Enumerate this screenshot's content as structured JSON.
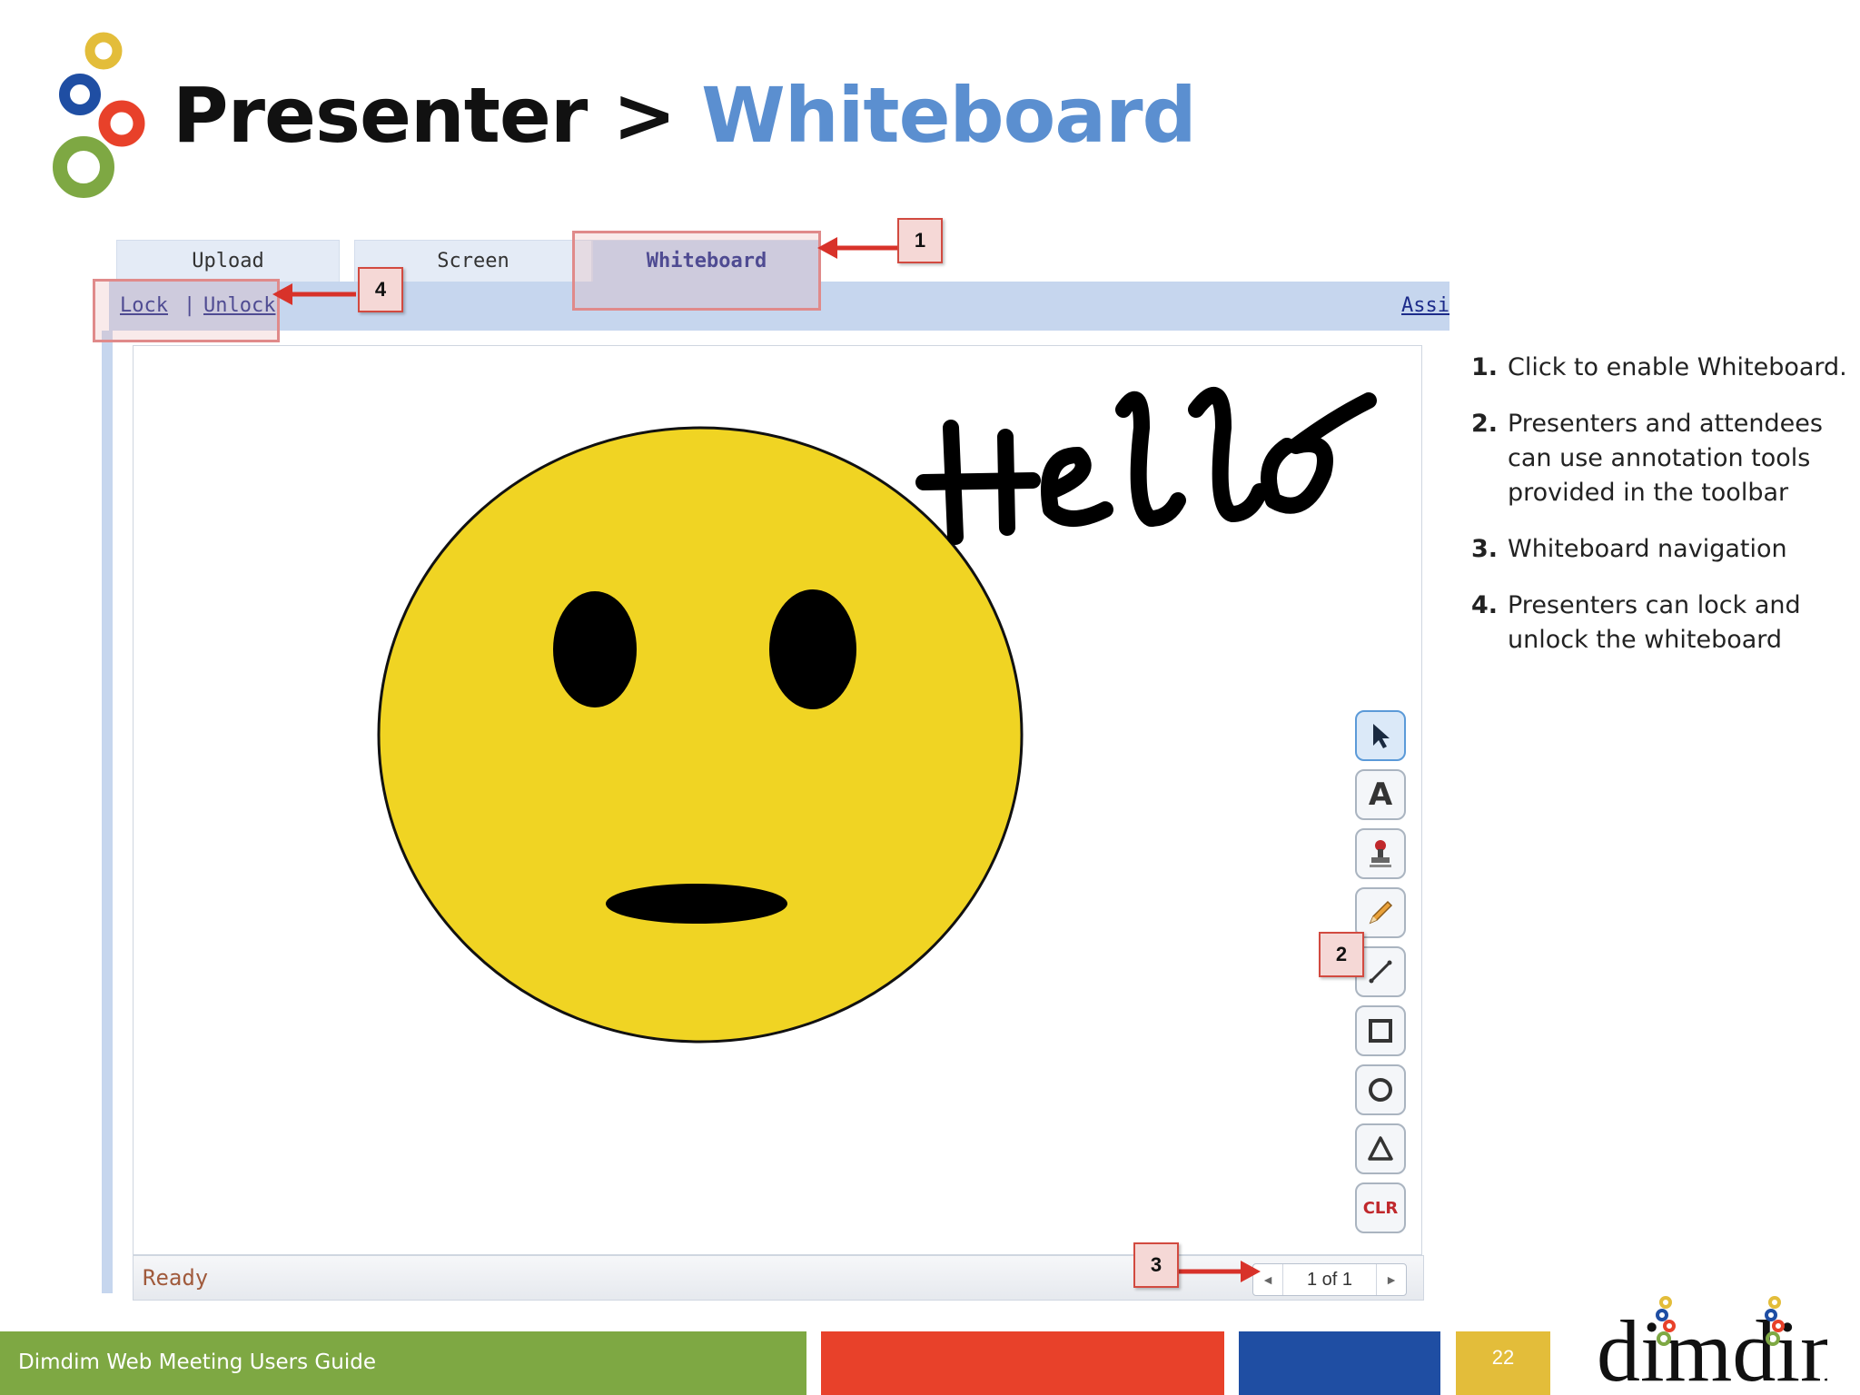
{
  "slide": {
    "title_part1": "Presenter >",
    "title_part2": "Whiteboard"
  },
  "tabs": [
    {
      "label": "Upload"
    },
    {
      "label": "Screen"
    },
    {
      "label": "Whiteboard"
    }
  ],
  "lock": {
    "lock_label": "Lock",
    "separator": "|",
    "unlock_label": "Unlock",
    "right_link": "Assi"
  },
  "canvas": {
    "drawn_text": "Hello"
  },
  "status": {
    "ready": "Ready",
    "page": "1 of 1",
    "prev_icon": "◄",
    "next_icon": "►"
  },
  "toolbar": {
    "tools": [
      "arrow-select-icon",
      "text-icon",
      "stamp-icon",
      "pencil-icon",
      "line-icon",
      "rectangle-icon",
      "circle-icon",
      "triangle-icon",
      "clear-icon"
    ],
    "clear_label": "CLR",
    "text_label": "A"
  },
  "callouts": {
    "c1": "1",
    "c2": "2",
    "c3": "3",
    "c4": "4"
  },
  "notes": [
    {
      "num": "1.",
      "text": "Click to enable Whiteboard."
    },
    {
      "num": "2.",
      "text": "Presenters and attendees can use annotation tools provided in the toolbar"
    },
    {
      "num": "3.",
      "text": "Whiteboard navigation"
    },
    {
      "num": "4.",
      "text": "Presenters can lock and unlock the whiteboard"
    }
  ],
  "footer": {
    "text": "Dimdim Web Meeting Users Guide",
    "page": "22",
    "logo": "dimdim"
  },
  "colors": {
    "green": "#7ea843",
    "red": "#e8412a",
    "blue": "#1f4ea3",
    "yellow": "#e3bd3a",
    "title_blue": "#5b8fd0",
    "face": "#f0d423"
  }
}
